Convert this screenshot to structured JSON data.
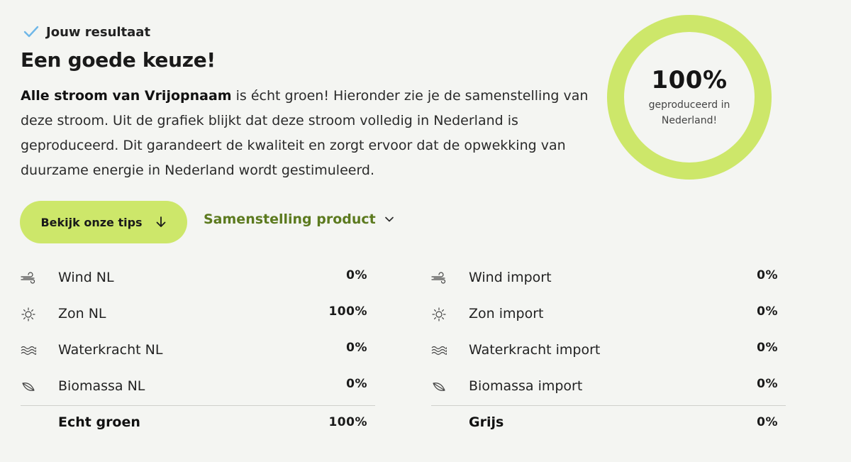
{
  "result": {
    "label": "Jouw resultaat",
    "headline": "Een goede keuze!",
    "intro_bold": "Alle stroom van Vrijopnaam",
    "intro_text": " is écht groen! Hieronder zie je de samenstelling van deze stroom. Uit de grafiek blijkt dat deze stroom volledig in Nederland is geproduceerd. Dit garandeert de kwaliteit en zorgt ervoor dat de opwekking van duurzame energie in Nederland wordt gestimuleerd."
  },
  "ring": {
    "value": "100%",
    "caption": "geproduceerd in Nederland!",
    "fraction": 1.0
  },
  "actions": {
    "tips_label": "Bekijk onze tips",
    "composition_label": "Samenstelling product"
  },
  "colors": {
    "accent": "#cde76a",
    "link": "#5c7a1f",
    "check": "#6fb7e8",
    "background": "#f4f5f2"
  },
  "netherlands": {
    "rows": [
      {
        "icon": "wind-icon",
        "label": "Wind NL",
        "value": "0%"
      },
      {
        "icon": "sun-icon",
        "label": "Zon NL",
        "value": "100%"
      },
      {
        "icon": "waves-icon",
        "label": "Waterkracht NL",
        "value": "0%"
      },
      {
        "icon": "leaf-icon",
        "label": "Biomassa NL",
        "value": "0%"
      }
    ],
    "total_label": "Echt groen",
    "total_value": "100%"
  },
  "import": {
    "rows": [
      {
        "icon": "wind-icon",
        "label": "Wind import",
        "value": "0%"
      },
      {
        "icon": "sun-icon",
        "label": "Zon import",
        "value": "0%"
      },
      {
        "icon": "waves-icon",
        "label": "Waterkracht import",
        "value": "0%"
      },
      {
        "icon": "leaf-icon",
        "label": "Biomassa import",
        "value": "0%"
      }
    ],
    "total_label": "Grijs",
    "total_value": "0%"
  }
}
